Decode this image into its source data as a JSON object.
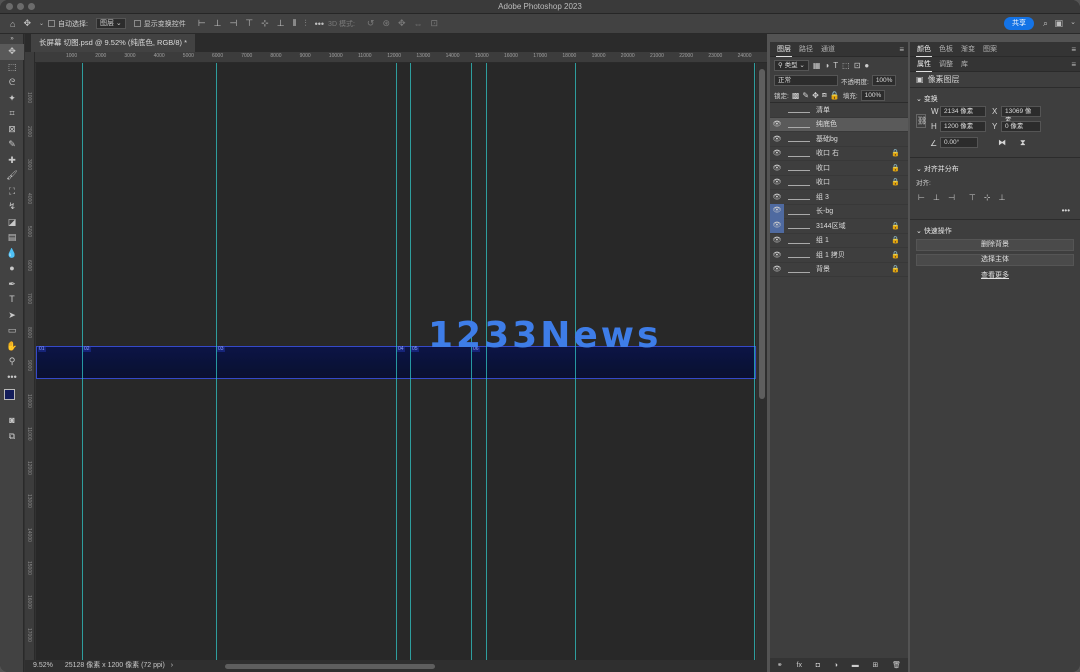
{
  "window": {
    "title": "Adobe Photoshop 2023"
  },
  "options": {
    "auto_select_label": "自动选择:",
    "auto_select_value": "图层",
    "show_transform_label": "显示变换控件",
    "mode_3d_label": "3D 模式:",
    "share_label": "共享"
  },
  "document": {
    "tab_title": "长屏幕 切图.psd @ 9.52% (纯底色, RGB/8) *",
    "watermark": "1233News",
    "slices": [
      "01",
      "02",
      "03",
      "04",
      "05",
      "06"
    ]
  },
  "ruler": {
    "h_labels": [
      "1000",
      "2000",
      "3000",
      "4000",
      "5000",
      "6000",
      "7000",
      "8000",
      "9000",
      "10000",
      "11000",
      "12000",
      "13000",
      "14000",
      "15000",
      "16000",
      "17000",
      "18000",
      "19000",
      "20000",
      "21000",
      "22000",
      "23000",
      "24000"
    ],
    "v_labels": [
      "1000",
      "2000",
      "3000",
      "4000",
      "5000",
      "6000",
      "7000",
      "8000",
      "9000",
      "10000",
      "11000",
      "12000",
      "13000",
      "14000",
      "15000",
      "16000",
      "17000"
    ]
  },
  "status": {
    "zoom": "9.52%",
    "doc_info": "25128 像素 x 1200 像素 (72 ppi)"
  },
  "layers_panel": {
    "tabs": [
      "图层",
      "路径",
      "通道"
    ],
    "filter": "类型",
    "blend": "正常",
    "opacity_label": "不透明度:",
    "opacity": "100%",
    "lock_label": "锁定:",
    "fill_label": "填充:",
    "fill": "100%",
    "layers": [
      {
        "name": "清单",
        "visible": false,
        "locked": false,
        "selected": false
      },
      {
        "name": "纯底色",
        "visible": true,
        "locked": false,
        "selected": true
      },
      {
        "name": "基础bg",
        "visible": true,
        "locked": false,
        "selected": false
      },
      {
        "name": "收口 右",
        "visible": true,
        "locked": true,
        "selected": false
      },
      {
        "name": "收口",
        "visible": true,
        "locked": true,
        "selected": false
      },
      {
        "name": "收口",
        "visible": true,
        "locked": true,
        "selected": false
      },
      {
        "name": "组 3",
        "visible": true,
        "locked": false,
        "selected": false
      },
      {
        "name": "长-bg",
        "visible": true,
        "locked": false,
        "selected": false
      },
      {
        "name": "3144区域",
        "visible": true,
        "locked": true,
        "selected": false
      },
      {
        "name": "组 1",
        "visible": true,
        "locked": true,
        "selected": false
      },
      {
        "name": "组 1 拷贝",
        "visible": true,
        "locked": true,
        "selected": false
      },
      {
        "name": "背景",
        "visible": true,
        "locked": true,
        "selected": false
      }
    ]
  },
  "right_panel": {
    "tabs_top": [
      "颜色",
      "色板",
      "渐变",
      "图案"
    ],
    "tabs_mid": [
      "属性",
      "调整",
      "库"
    ],
    "pixel_layer_label": "像素图层",
    "transform_label": "变换",
    "w_label": "W",
    "w_value": "2134 像素",
    "x_label": "X",
    "x_value": "13069 像素",
    "h_label": "H",
    "h_value": "1200 像素",
    "y_label": "Y",
    "y_value": "0 像素",
    "angle_value": "0.00°",
    "align_label": "对齐并分布",
    "align_sub": "对齐:",
    "quick_label": "快速操作",
    "remove_bg": "删除背景",
    "select_subject": "选择主体",
    "see_more": "查看更多"
  }
}
